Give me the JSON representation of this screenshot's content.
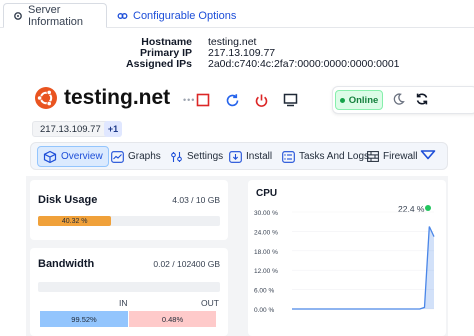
{
  "tabs": {
    "server_info": "Server Information",
    "configurable": "Configurable Options"
  },
  "server_info": {
    "hostname_label": "Hostname",
    "hostname_value": "testing.net",
    "primary_ip_label": "Primary IP",
    "primary_ip_value": "217.13.109.77",
    "assigned_ips_label": "Assigned IPs",
    "assigned_ips_value": "2a0d:c740:4c:2fa7:0000:0000:0000:0001"
  },
  "header": {
    "server_name": "testing.net",
    "status": "Online",
    "status_color": "#16a34a",
    "controls": [
      "stop-icon",
      "restart-icon",
      "power-icon",
      "console-icon"
    ]
  },
  "ip_row": {
    "ip": "217.13.109.77",
    "more": "+1"
  },
  "nav": {
    "overview": "Overview",
    "graphs": "Graphs",
    "settings": "Settings",
    "install": "Install",
    "tasks": "Tasks And Logs",
    "firewall": "Firewall"
  },
  "disk": {
    "title": "Disk Usage",
    "value": "4.03 / 10 GB",
    "percent_label": "40.32 %",
    "percent": 40.32,
    "color": "#f0a13a"
  },
  "bandwidth": {
    "title": "Bandwidth",
    "value": "0.02 / 102400 GB",
    "in_label": "IN",
    "out_label": "OUT",
    "in_value": "99.52%",
    "out_value": "0.48%",
    "in_color": "#93c5fd",
    "out_color": "#fecaca"
  },
  "cpu": {
    "title": "CPU",
    "current": "22.4 %",
    "current_color": "#22c55e"
  },
  "chart_data": {
    "type": "area",
    "title": "CPU",
    "yticks": [
      "30.00 %",
      "24.00 %",
      "18.00 %",
      "12.00 %",
      "6.00 %",
      "0.00 %"
    ],
    "ylim": [
      0,
      30
    ],
    "values": [
      0,
      0,
      0,
      0,
      0,
      0,
      0,
      0,
      0,
      0,
      0,
      0,
      0,
      0,
      0,
      0,
      0,
      0,
      0,
      0,
      0,
      0,
      0,
      0,
      0,
      0,
      0,
      0,
      0.5,
      25.5,
      22.4
    ],
    "color": "#4a86e8"
  }
}
